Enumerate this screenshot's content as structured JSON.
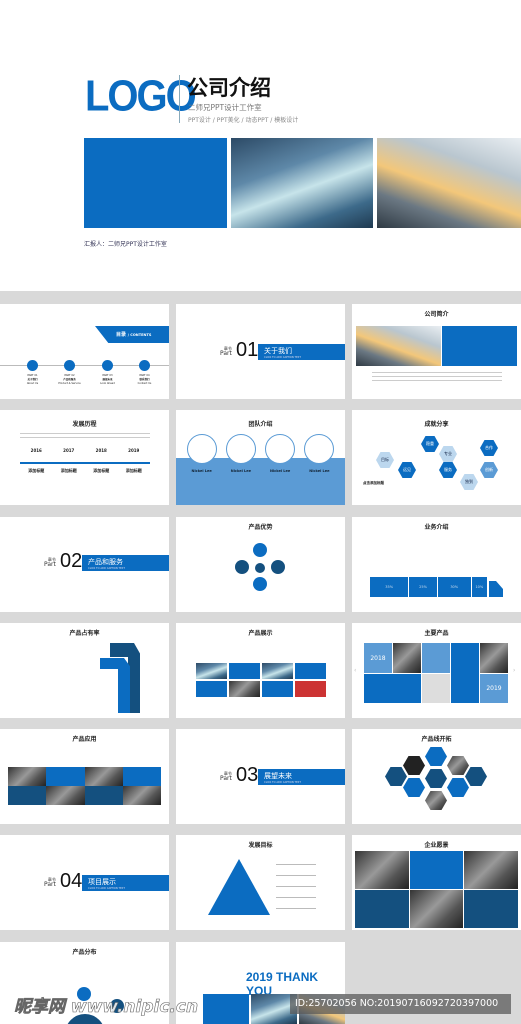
{
  "cover": {
    "logo": "LOGO",
    "title": "公司介绍",
    "subtitle": "二师兄PPT设计工作室",
    "tagline": "PPT设计 / PPT美化 / 动态PPT / 模板设计",
    "reporter": "汇报人：二师兄PPT设计工作室"
  },
  "contents": {
    "title": "目录",
    "title_en": "/ CONTENTS",
    "items": [
      {
        "part": "PART 01",
        "label": "关于我们",
        "en": "About Us"
      },
      {
        "part": "PART 02",
        "label": "产品和服务",
        "en": "Product & Service"
      },
      {
        "part": "PART 03",
        "label": "展望未来",
        "en": "Look Ahead"
      },
      {
        "part": "PART 04",
        "label": "联系我们",
        "en": "Contact Us"
      }
    ]
  },
  "sections": [
    {
      "chapter": "章节",
      "part": "Part",
      "num": "01",
      "title": "关于我们",
      "caption": "CLICK TO ADD CAPTION TEXT"
    },
    {
      "chapter": "章节",
      "part": "Part",
      "num": "02",
      "title": "产品和服务",
      "caption": "CLICK TO ADD CAPTION TEXT"
    },
    {
      "chapter": "章节",
      "part": "Part",
      "num": "03",
      "title": "展望未来",
      "caption": "CLICK TO ADD CAPTION TEXT"
    },
    {
      "chapter": "章节",
      "part": "Part",
      "num": "04",
      "title": "项目展示",
      "caption": "CLICK TO ADD CAPTION TEXT"
    }
  ],
  "slide_titles": {
    "intro": "公司简介",
    "history": "发展历程",
    "team": "团队介绍",
    "achievements": "成就分享",
    "advantages": "产品优势",
    "business": "业务介绍",
    "share": "产品占有率",
    "showcase": "产品展示",
    "main_products": "主要产品",
    "application": "产品应用",
    "expansion": "产品线开拓",
    "goals": "发展目标",
    "vision": "企业愿景",
    "distribution": "产品分布"
  },
  "history": {
    "years": [
      "2016",
      "2017",
      "2018",
      "2019"
    ],
    "item_title": "添加标题"
  },
  "team": {
    "members": [
      "Nickel Lee",
      "Nickel Lee",
      "Nickel Lee",
      "Nickel Lee"
    ]
  },
  "achievements": {
    "hexes": [
      "稳重",
      "专业",
      "合作",
      "目标",
      "远见",
      "服务",
      "创新",
      "独到"
    ],
    "heading": "点击添加标题"
  },
  "business": {
    "percents": [
      "35%",
      "25%",
      "30%",
      "10%"
    ]
  },
  "main_products": {
    "year_a": "2018",
    "year_b": "2019"
  },
  "thanks": {
    "year": "2019",
    "text": "THANK YOU"
  },
  "watermark": {
    "logo": "昵享网 www.nipic.cn",
    "id": "ID:25702056 NO:20190716092720397000"
  },
  "colors": {
    "accent": "#0b6cc1",
    "dark": "#14507f",
    "light": "#5b9bd5",
    "background": "#d9d9d9"
  }
}
